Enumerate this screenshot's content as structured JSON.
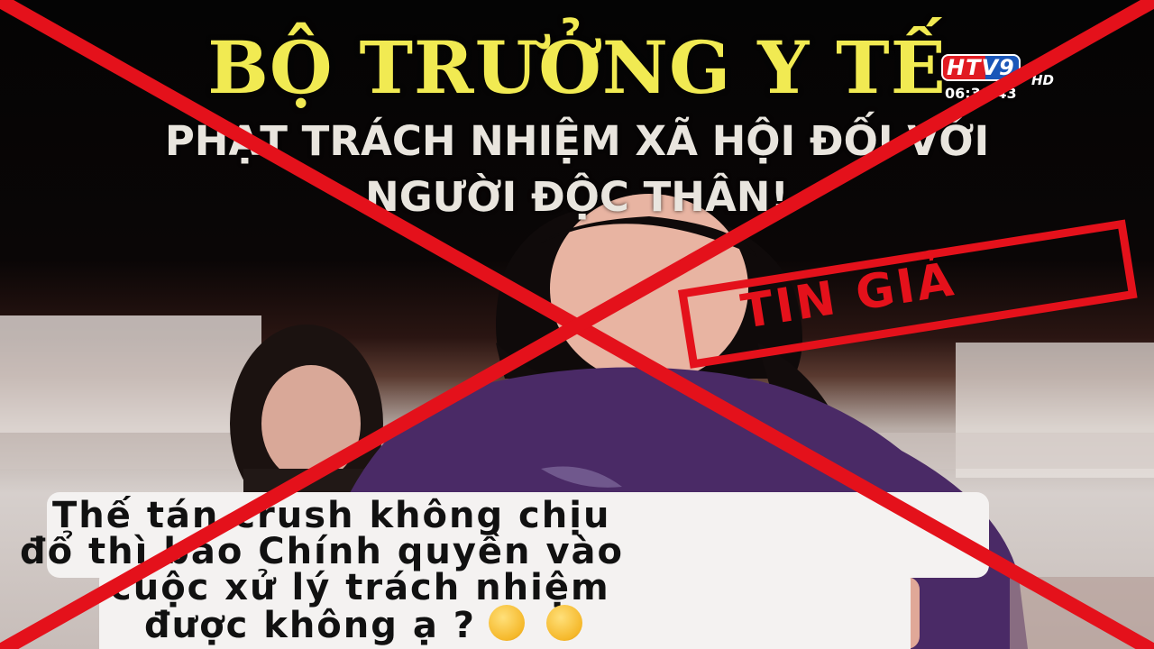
{
  "headline": {
    "main": "BỘ TRƯỞNG Y TẾ",
    "sub": "PHẠT TRÁCH NHIỆM XÃ HỘI ĐỐI VỚI NGƯỜI ĐỘC THÂN!"
  },
  "channel": {
    "logo_text": "HTV9",
    "hd_label": "HD",
    "clock": "06:30:43"
  },
  "stamp": {
    "label": "TIN GIẢ"
  },
  "caption": {
    "lines": [
      "Thế tán crush không chịu",
      "đổ thì báo Chính quyền vào",
      "cuộc xử lý trách nhiệm",
      "được không ạ ?"
    ],
    "emojis": [
      "thinking-face-emoji",
      "hand-over-mouth-emoji"
    ]
  },
  "colors": {
    "headline_yellow": "#f1ea52",
    "cross_red": "#e4111b",
    "caption_bg": "#f4f2f1",
    "dress_purple": "#4a2a66"
  }
}
